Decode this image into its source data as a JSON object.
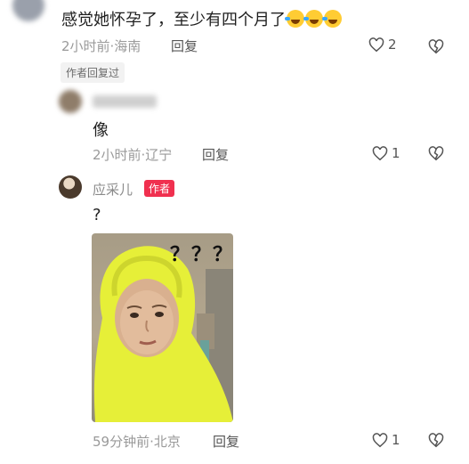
{
  "comment1": {
    "text": "感觉她怀孕了，至少有四个月了",
    "emojis": [
      "laugh-cry-emoji",
      "laugh-cry-emoji",
      "laugh-cry-emoji"
    ],
    "meta": "2小时前·海南",
    "reply_label": "回复",
    "likes": "2",
    "author_replied_tag": "作者回复过"
  },
  "reply1": {
    "username": "",
    "text": "像",
    "meta": "2小时前·辽宁",
    "reply_label": "回复",
    "likes": "1"
  },
  "reply2": {
    "username": "应采儿",
    "author_badge": "作者",
    "text": "?",
    "sticker_caption": "？？？",
    "meta": "59分钟前·北京",
    "reply_label": "回复",
    "likes": "1"
  },
  "colors": {
    "author_badge_bg": "#f0304f",
    "sticker_hood": "#e8f03a",
    "meta_text": "#9a9a9a"
  }
}
